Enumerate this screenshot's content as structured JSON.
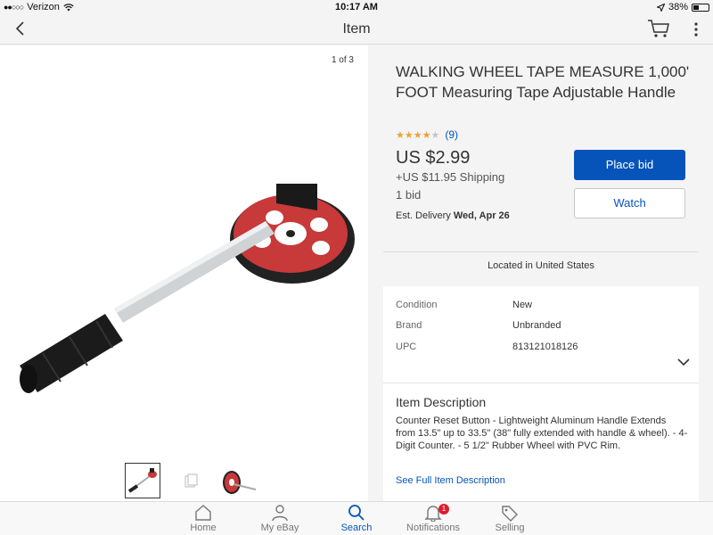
{
  "status_bar": {
    "carrier": "Verizon",
    "time": "10:17 AM",
    "battery": "38%",
    "battery_level": 0.38
  },
  "nav": {
    "title": "Item",
    "back_icon": "chevron-left-icon",
    "cart_icon": "cart-icon",
    "more_icon": "more-vertical-icon"
  },
  "gallery": {
    "pager": "1 of 3",
    "product_image": "walking-wheel-tape-measure",
    "thumbnails": [
      "thumbnail-1",
      "thumbnail-2",
      "thumbnail-3"
    ]
  },
  "item": {
    "title": "WALKING WHEEL TAPE MEASURE 1,000' FOOT Measuring Tape Adjustable Handle",
    "rating_stars": 4,
    "rating_count": "(9)",
    "price": "US $2.99",
    "shipping": "+US $11.95 Shipping",
    "bids": "1 bid",
    "delivery_label": "Est. Delivery",
    "delivery_date": "Wed, Apr 26",
    "place_bid_label": "Place bid",
    "watch_label": "Watch",
    "location": "Located in United States"
  },
  "specifics": [
    {
      "key": "Condition",
      "value": "New"
    },
    {
      "key": "Brand",
      "value": "Unbranded"
    },
    {
      "key": "UPC",
      "value": "813121018126"
    }
  ],
  "description": {
    "title": "Item Description",
    "body": "Counter Reset Button - Lightweight Aluminum Handle Extends from 13.5\" up to 33.5\" (38\" fully extended with handle & wheel). - 4-Digit Counter. - 5 1/2\" Rubber Wheel with PVC Rim.",
    "link": "See Full Item Description"
  },
  "tabbar": {
    "home": "Home",
    "my_ebay": "My eBay",
    "search": "Search",
    "notifications": "Notifications",
    "notifications_badge": "1",
    "selling": "Selling"
  },
  "colors": {
    "accent": "#0654ba",
    "star": "#f1a231",
    "badge": "#dd1e31"
  }
}
